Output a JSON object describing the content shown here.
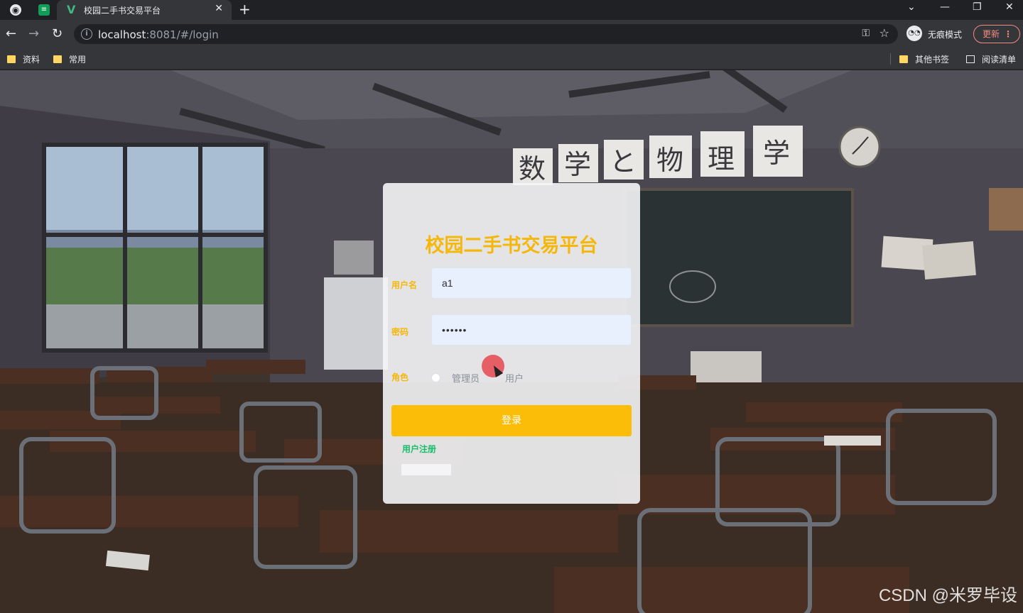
{
  "browser": {
    "tab_title": "校园二手书交易平台",
    "url_host": "localhost",
    "url_rest": ":8081/#/login",
    "incognito_label": "无痕模式",
    "update_label": "更新",
    "bookmarks": [
      "资料",
      "常用"
    ],
    "other_bookmarks": "其他书签",
    "reading_list": "阅读清单"
  },
  "background": {
    "banner_chars": [
      "数",
      "学",
      "と",
      "物",
      "理",
      "学"
    ]
  },
  "login": {
    "title": "校园二手书交易平台",
    "username_label": "用户名",
    "username_value": "a1",
    "password_label": "密码",
    "password_value": "••••••",
    "role_label": "角色",
    "role_options": [
      "管理员",
      "用户"
    ],
    "submit_label": "登录",
    "register_label": "用户注册"
  },
  "watermark": "CSDN @米罗毕设",
  "colors": {
    "accent": "#fbbd08",
    "title": "#f5b70a",
    "link": "#19be6b"
  }
}
